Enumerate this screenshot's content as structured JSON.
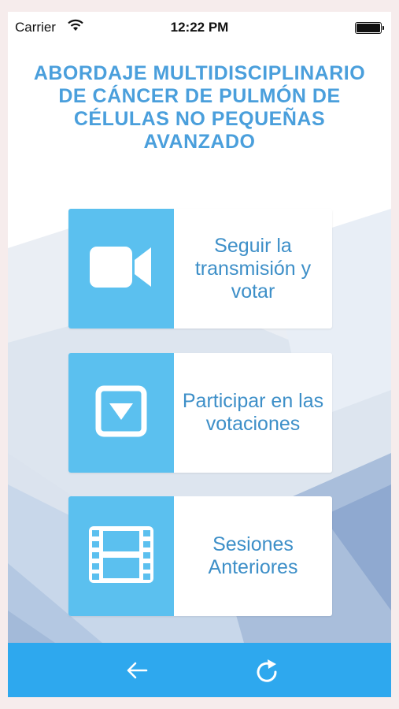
{
  "status": {
    "carrier": "Carrier",
    "time": "12:22 PM"
  },
  "title": "ABORDAJE MULTIDISCIPLINARIO DE CÁNCER DE PULMÓN DE CÉLULAS NO PEQUEÑAS AVANZADO",
  "menu": [
    {
      "label": "Seguir la transmisión y votar",
      "icon": "video-camera-icon"
    },
    {
      "label": "Participar en las votaciones",
      "icon": "dropdown-box-icon"
    },
    {
      "label": "Sesiones Anteriores",
      "icon": "film-strip-icon"
    }
  ],
  "bottom_nav": {
    "back_icon": "back-arrow-icon",
    "refresh_icon": "refresh-icon"
  },
  "colors": {
    "accent": "#5bc0ef",
    "title": "#4a9fdc",
    "label": "#3d8fc8",
    "bottom_bar": "#2ea8ee"
  }
}
